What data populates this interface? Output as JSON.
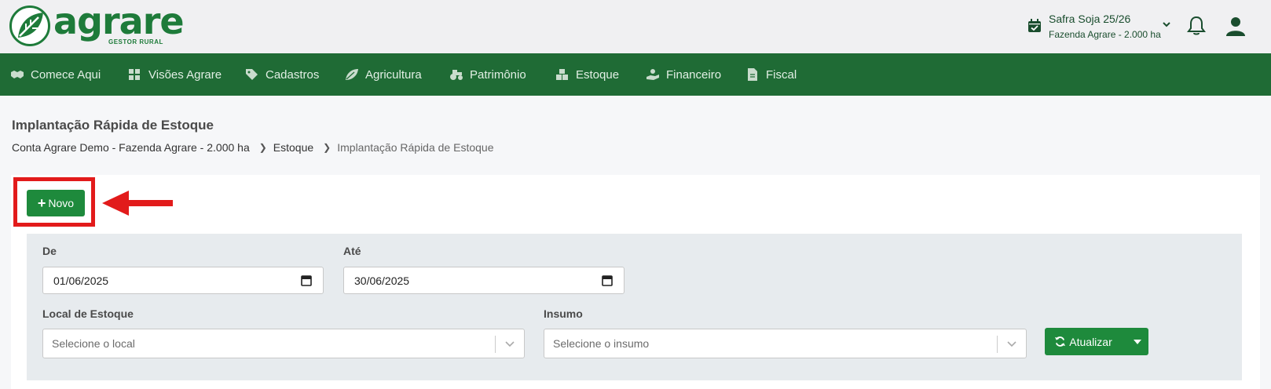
{
  "header": {
    "logo_text": "agrare",
    "logo_subtitle": "GESTOR RURAL",
    "safra_title": "Safra Soja 25/26",
    "safra_subtitle": "Fazenda Agrare - 2.000 ha"
  },
  "nav": {
    "items": [
      {
        "label": "Comece Aqui",
        "icon": "handshake-icon"
      },
      {
        "label": "Visões Agrare",
        "icon": "grid-icon"
      },
      {
        "label": "Cadastros",
        "icon": "tags-icon"
      },
      {
        "label": "Agricultura",
        "icon": "leaf-icon"
      },
      {
        "label": "Patrimônio",
        "icon": "tractor-icon"
      },
      {
        "label": "Estoque",
        "icon": "boxes-icon"
      },
      {
        "label": "Financeiro",
        "icon": "hand-coin-icon"
      },
      {
        "label": "Fiscal",
        "icon": "document-icon"
      }
    ]
  },
  "page": {
    "title": "Implantação Rápida de Estoque",
    "breadcrumb": [
      "Conta Agrare Demo - Fazenda Agrare - 2.000 ha",
      "Estoque",
      "Implantação Rápida de Estoque"
    ]
  },
  "actions": {
    "novo_label": "Novo"
  },
  "filters": {
    "de_label": "De",
    "de_value": "01/06/2025",
    "ate_label": "Até",
    "ate_value": "30/06/2025",
    "local_label": "Local de Estoque",
    "local_placeholder": "Selecione o local",
    "insumo_label": "Insumo",
    "insumo_placeholder": "Selecione o insumo",
    "atualizar_label": "Atualizar"
  },
  "colors": {
    "brand_green": "#1e7b3a",
    "nav_green": "#1f6b35",
    "button_green": "#1e8a3c",
    "highlight_red": "#e21b1b"
  }
}
